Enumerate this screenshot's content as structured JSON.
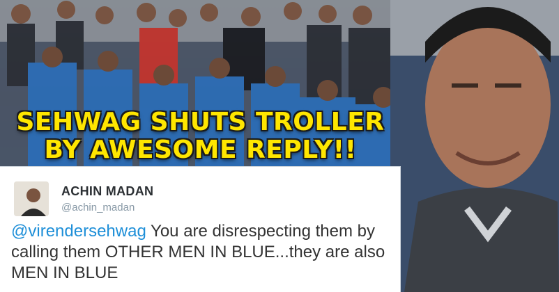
{
  "headline": {
    "line1": "SEHWAG SHUTS TROLLER",
    "line2": "BY AWESOME REPLY!!"
  },
  "tweet": {
    "user_name": "ACHIN MADAN",
    "user_handle": "@achin_madan",
    "mention": "@virendersehwag",
    "text": "You are disrespecting them by calling them OTHER MEN IN BLUE...they are also MEN IN BLUE"
  },
  "colors": {
    "headline": "#ffe600",
    "mention": "#1e8fd8",
    "team_jersey": "#2d6db5"
  }
}
